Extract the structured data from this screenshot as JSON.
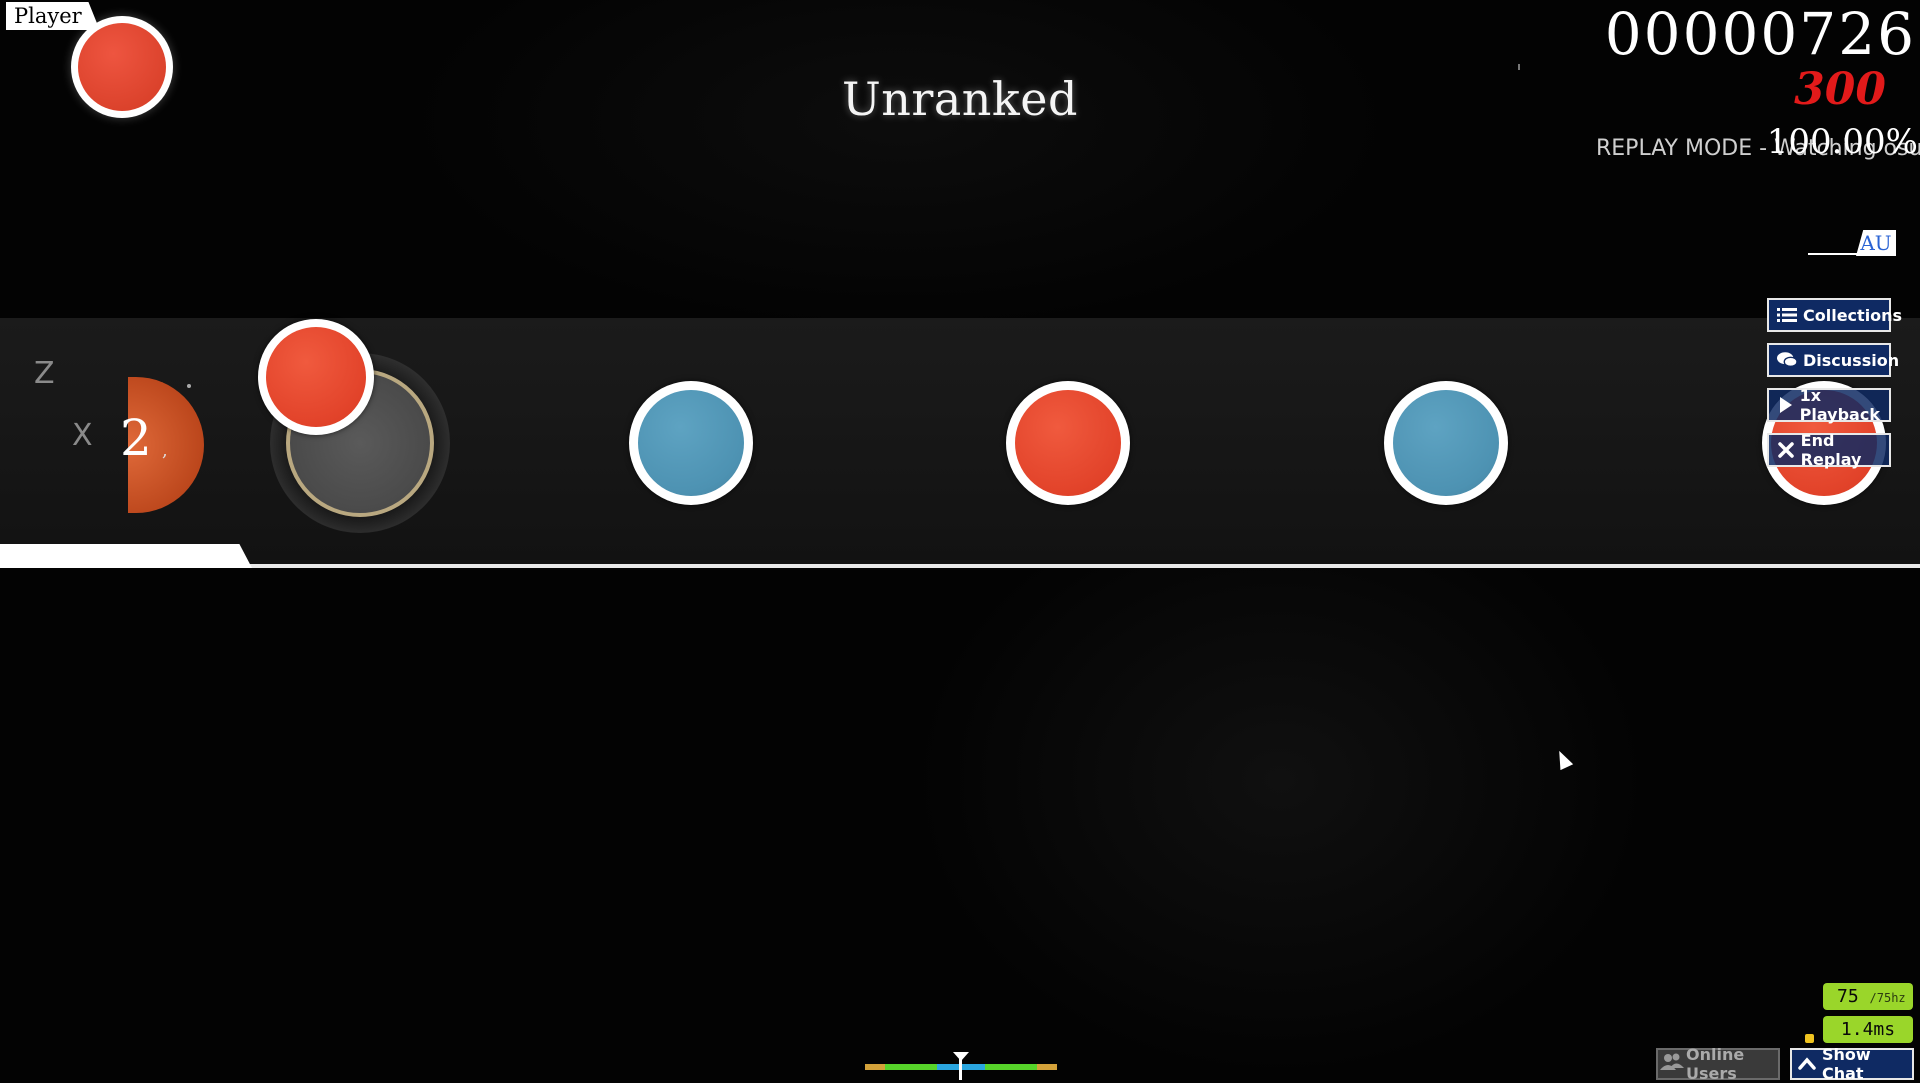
{
  "hud": {
    "player_name": "Player",
    "status_title": "Unranked",
    "score": "00000726",
    "combo_score": "300",
    "replay_mode_text": "REPLAY MODE - Watching osu!",
    "accuracy": "100.00%",
    "country_code": "AU"
  },
  "playfield": {
    "key_left": "Z",
    "key_right": "X",
    "combo": "2",
    "notes": [
      {
        "color": "red",
        "state": "hit"
      },
      {
        "color": "blue",
        "state": "incoming"
      },
      {
        "color": "red",
        "state": "incoming"
      },
      {
        "color": "blue",
        "state": "incoming"
      },
      {
        "color": "red",
        "state": "incoming"
      }
    ],
    "colors": {
      "don": "#e2432a",
      "ka": "#4d92b2",
      "lane": "#1b1b1b"
    }
  },
  "side_menu": {
    "collections": "Collections",
    "discussion": "Discussion",
    "playback": "1x Playback",
    "end_replay": "End Replay"
  },
  "stats": {
    "fps": "75",
    "fps_target": "/75hz",
    "latency": "1.4ms"
  },
  "bottom_bar": {
    "online_users": "Online Users",
    "show_chat": "Show Chat"
  },
  "icons": {
    "collections": "list-icon",
    "discussion": "chat-bubble-icon",
    "playback": "play-icon",
    "end_replay": "close-icon",
    "online_users": "users-icon",
    "show_chat": "chevron-up-icon"
  }
}
